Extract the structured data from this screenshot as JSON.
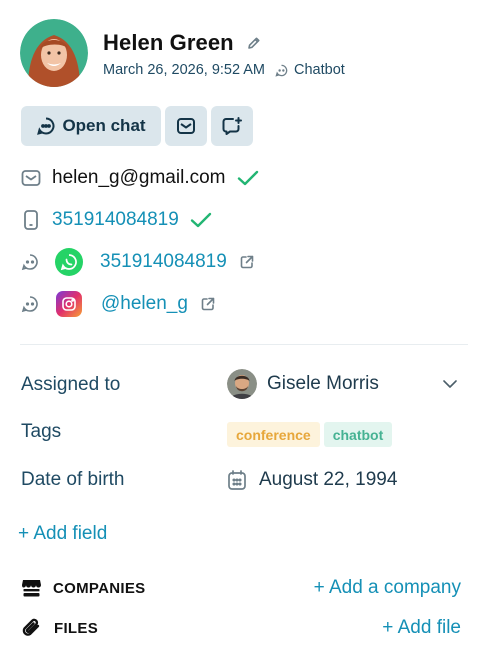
{
  "contact": {
    "name": "Helen Green",
    "created": "March 26, 2026, 9:52 AM",
    "source": "Chatbot"
  },
  "actions": {
    "open_chat_label": "Open chat"
  },
  "channels": {
    "email": "helen_g@gmail.com",
    "phone": "351914084819",
    "whatsapp": "351914084819",
    "instagram": "@helen_g"
  },
  "fields": {
    "assigned_label": "Assigned to",
    "assigned_value": "Gisele Morris",
    "tags_label": "Tags",
    "tags": [
      "conference",
      "chatbot"
    ],
    "dob_label": "Date of birth",
    "dob_value": "August 22, 1994",
    "add_field_label": "+ Add field"
  },
  "sections": {
    "companies_title": "COMPANIES",
    "companies_add": "+ Add a company",
    "files_title": "FILES",
    "files_add": "+ Add file"
  },
  "icons": [
    "pencil-icon",
    "chatbot-icon",
    "chat-bubble-icon",
    "mail-icon",
    "add-chat-icon",
    "check-icon",
    "phone-icon",
    "whatsapp-icon",
    "instagram-icon",
    "external-link-icon",
    "chevron-down-icon",
    "calendar-icon",
    "store-icon",
    "paperclip-icon"
  ],
  "colors": {
    "accent": "#1590b6",
    "verified": "#22b573",
    "button_bg": "#dbe6ec",
    "whatsapp": "#25d366",
    "tag_conference_bg": "#fdf3dc",
    "tag_conference_text": "#e7a73b",
    "tag_chatbot_bg": "#e3f5ef",
    "tag_chatbot_text": "#46b293"
  }
}
